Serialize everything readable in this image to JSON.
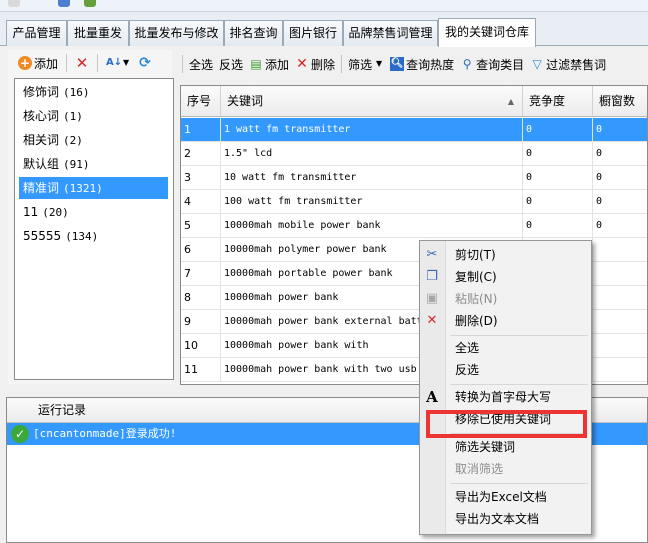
{
  "tabs": [
    {
      "label": "产品管理"
    },
    {
      "label": "批量重发"
    },
    {
      "label": "批量发布与修改"
    },
    {
      "label": "排名查询"
    },
    {
      "label": "图片银行"
    },
    {
      "label": "品牌禁售词管理"
    },
    {
      "label": "我的关键词仓库"
    }
  ],
  "left_toolbar": {
    "add": "添加"
  },
  "categories": [
    {
      "name": "修饰词",
      "count": "(16)"
    },
    {
      "name": "核心词",
      "count": "(1)"
    },
    {
      "name": "相关词",
      "count": "(2)"
    },
    {
      "name": "默认组",
      "count": "(91)"
    },
    {
      "name": "精准词",
      "count": "(1321)"
    },
    {
      "name": "11",
      "count": "(20)"
    },
    {
      "name": "55555",
      "count": "(134)"
    }
  ],
  "right_toolbar": {
    "select_all": "全选",
    "invert": "反选",
    "add": "添加",
    "delete": "删除",
    "filter": "筛选",
    "query_heat": "查询热度",
    "query_category": "查询类目",
    "filter_banned": "过滤禁售词"
  },
  "grid": {
    "headers": [
      "序号",
      "关键词",
      "竞争度",
      "橱窗数"
    ],
    "rows": [
      [
        "1",
        "1 watt fm transmitter",
        "0",
        "0"
      ],
      [
        "2",
        "1.5\" lcd",
        "0",
        "0"
      ],
      [
        "3",
        "10 watt fm transmitter",
        "0",
        "0"
      ],
      [
        "4",
        "100 watt fm transmitter",
        "0",
        "0"
      ],
      [
        "5",
        "10000mah mobile power bank",
        "0",
        "0"
      ],
      [
        "6",
        "10000mah polymer power bank",
        "",
        ""
      ],
      [
        "7",
        "10000mah portable power bank",
        "",
        ""
      ],
      [
        "8",
        "10000mah power bank",
        "",
        ""
      ],
      [
        "9",
        "10000mah power bank external batt",
        "",
        ""
      ],
      [
        "10",
        "10000mah power bank with",
        "",
        ""
      ],
      [
        "11",
        "10000mah power bank with two usb",
        "",
        ""
      ]
    ]
  },
  "log": {
    "title": "运行记录",
    "entry": "[cncantonmade]登录成功!"
  },
  "context_menu": {
    "cut": "剪切(T)",
    "copy": "复制(C)",
    "paste": "粘贴(N)",
    "delete": "删除(D)",
    "select_all": "全选",
    "invert": "反选",
    "capitalize": "转换为首字母大写",
    "remove_used": "移除已使用关键词",
    "filter_kw": "筛选关键词",
    "cancel_filter": "取消筛选",
    "export_excel": "导出为Excel文档",
    "export_text": "导出为文本文档"
  },
  "colors": {
    "selection": "#3399ff",
    "highlight_box": "#ee3333"
  }
}
